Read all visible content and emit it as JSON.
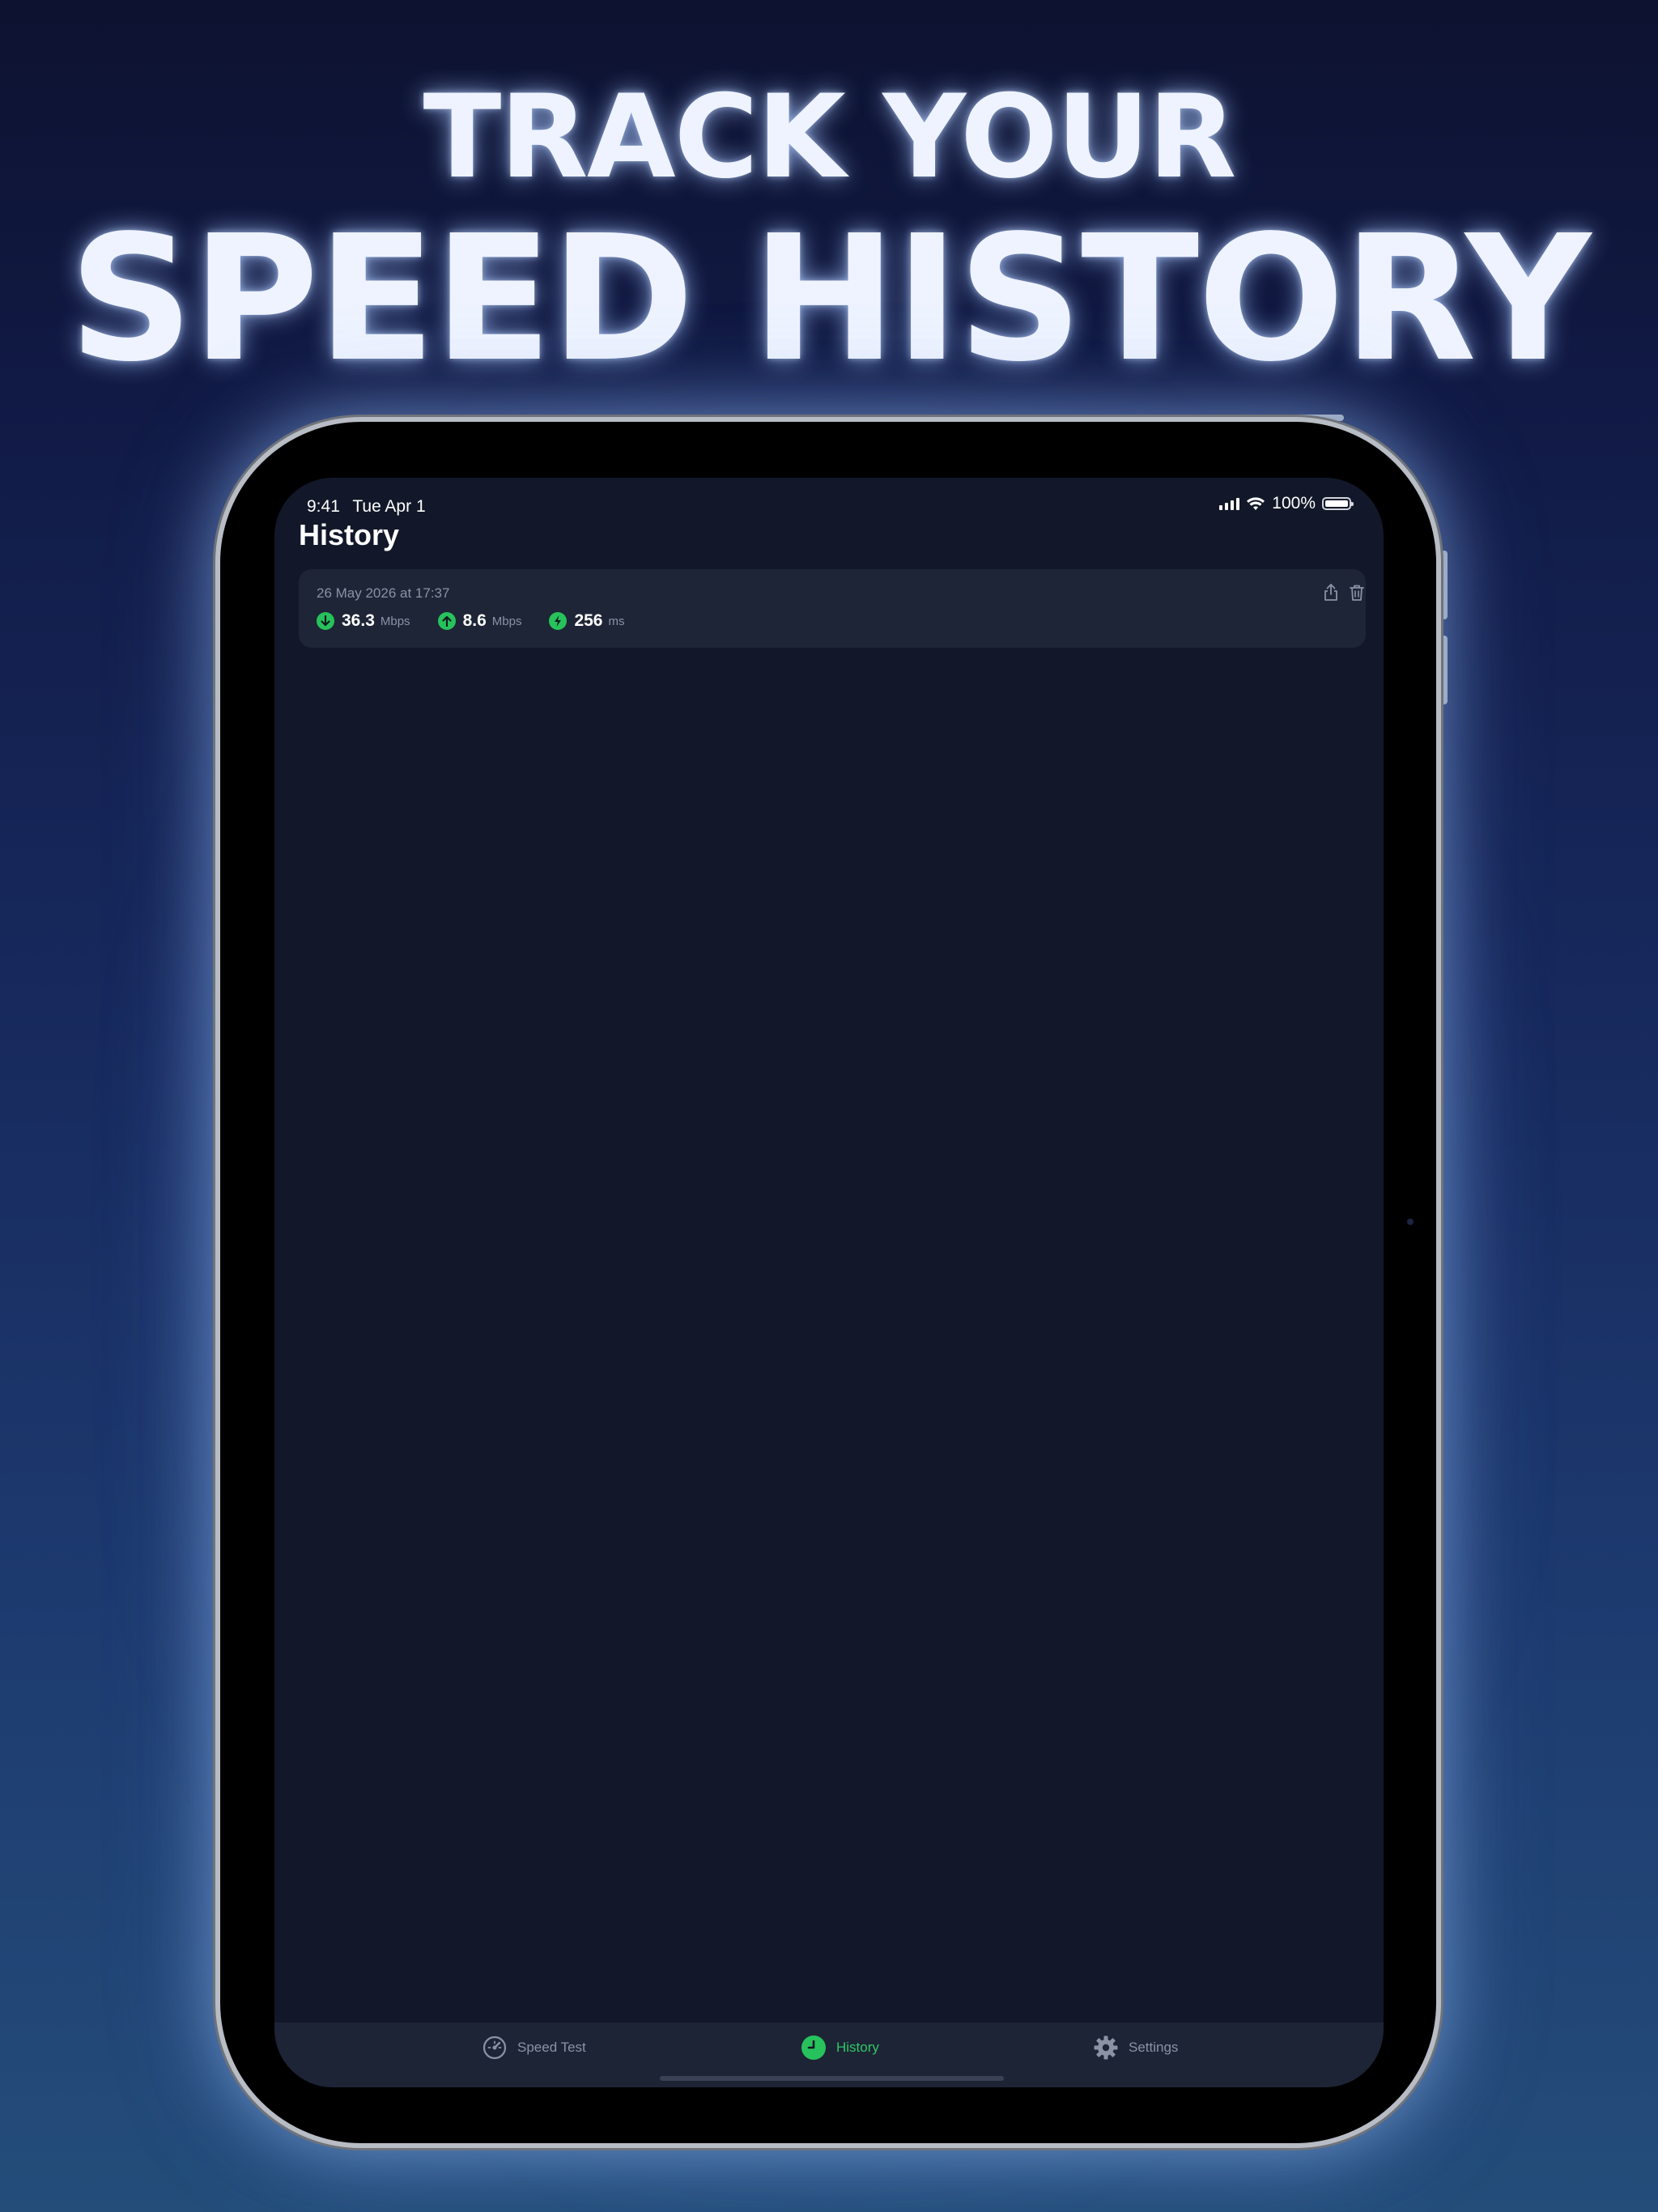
{
  "headline": {
    "line1": "TRACK YOUR",
    "line2": "SPEED HISTORY"
  },
  "status_bar": {
    "time": "9:41",
    "date": "Tue Apr 1",
    "battery": "100%"
  },
  "page": {
    "title": "History"
  },
  "history": [
    {
      "date": "26 May 2026 at 17:37",
      "download": {
        "value": "36.3",
        "unit": "Mbps",
        "icon": "arrow-down-icon"
      },
      "upload": {
        "value": "8.6",
        "unit": "Mbps",
        "icon": "arrow-up-icon"
      },
      "ping": {
        "value": "256",
        "unit": "ms",
        "icon": "lightning-icon"
      },
      "actions": [
        "share-icon",
        "trash-icon"
      ]
    }
  ],
  "tab_bar": {
    "tabs": [
      {
        "label": "Speed Test",
        "icon": "speedometer-icon",
        "active": false
      },
      {
        "label": "History",
        "icon": "clock-icon",
        "active": true
      },
      {
        "label": "Settings",
        "icon": "gear-icon",
        "active": false
      }
    ]
  },
  "colors": {
    "accent": "#27c25c",
    "screen_background": "#121829",
    "card_background": "#1e2536",
    "muted_text": "#8a92a6"
  }
}
